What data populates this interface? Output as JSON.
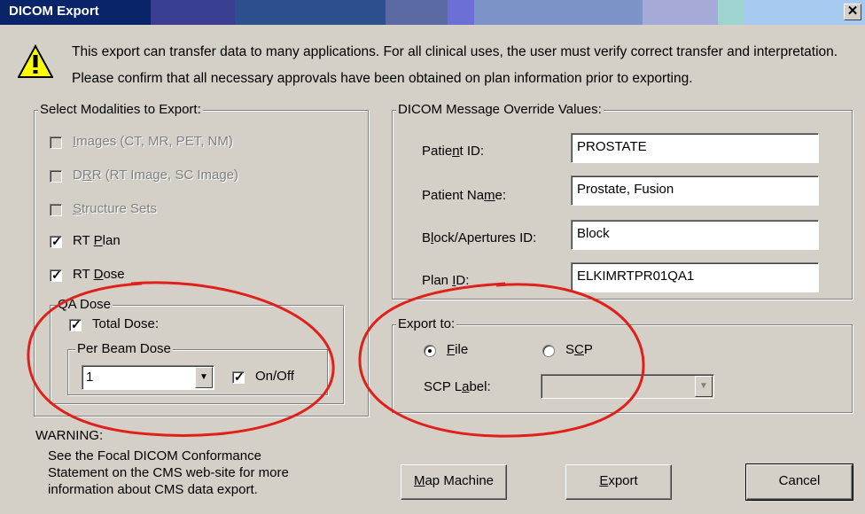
{
  "window": {
    "title": "DICOM Export",
    "close_glyph": "✕"
  },
  "messages": {
    "line1": "This export can transfer data to many applications. For all clinical uses, the user must verify correct transfer and interpretation.",
    "line2": "Please confirm that all necessary approvals have been obtained on plan information prior to exporting.",
    "icon": "warning-icon"
  },
  "modalities": {
    "legend": "Select Modalities to Export:",
    "items": [
      {
        "label": "Images (CT, MR, PET, NM)",
        "checked": false,
        "enabled": false
      },
      {
        "label": "DRR (RT Image, SC Image)",
        "checked": false,
        "enabled": false
      },
      {
        "label": "Structure Sets",
        "checked": false,
        "enabled": false
      },
      {
        "label": "RT Plan",
        "checked": true,
        "enabled": true
      },
      {
        "label": "RT Dose",
        "checked": true,
        "enabled": true
      }
    ]
  },
  "qa_dose": {
    "legend": "QA Dose",
    "total_dose_label": "Total Dose:",
    "total_dose_checked": true,
    "per_beam": {
      "legend": "Per Beam Dose",
      "selected": "1",
      "onoff_label": "On/Off",
      "onoff_checked": true
    }
  },
  "overrides": {
    "legend": "DICOM Message Override Values:",
    "fields": [
      {
        "label": "Patient ID:",
        "value": "PROSTATE"
      },
      {
        "label": "Patient Name:",
        "value": "Prostate, Fusion"
      },
      {
        "label": "Block/Apertures ID:",
        "value": "Block"
      },
      {
        "label": "Plan ID:",
        "value": "ELKIMRTPR01QA1"
      }
    ]
  },
  "export_to": {
    "legend": "Export to:",
    "file_label": "File",
    "scp_label": "SCP",
    "selected": "File",
    "scp_field_label": "SCP Label:",
    "scp_value": ""
  },
  "warning": {
    "title": "WARNING:",
    "lines": [
      "See the Focal DICOM Conformance",
      "Statement on the CMS web-site for more",
      "information about CMS data export."
    ]
  },
  "buttons": {
    "map_machine": "Map Machine",
    "export": "Export",
    "cancel": "Cancel"
  },
  "colors": {
    "dialog_bg": "#d4d0c8",
    "title_bar": "#0a246a",
    "annotation_ellipse": "#e0201a"
  }
}
